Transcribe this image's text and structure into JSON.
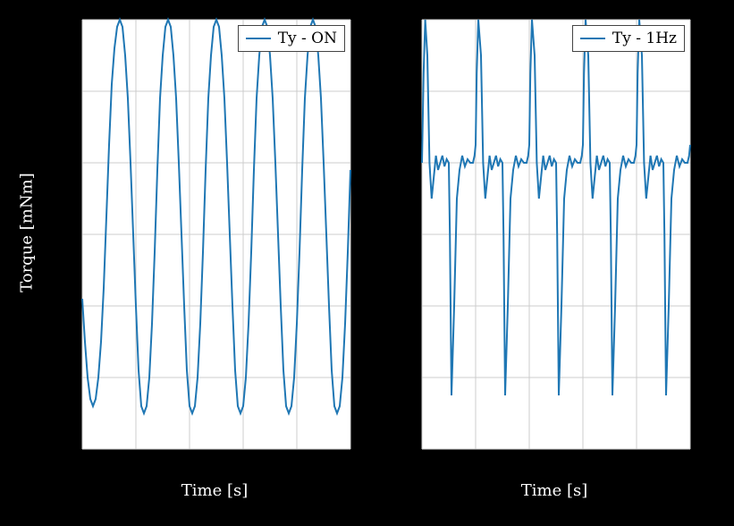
{
  "chart_data": [
    {
      "type": "line",
      "legend": "Ty - ON",
      "xlabel": "Time [s]",
      "ylabel": "Torque [mNm]",
      "xlim": [
        0,
        5
      ],
      "ylim": [
        -60,
        60
      ],
      "xticks": [
        0,
        1,
        2,
        3,
        4,
        5
      ],
      "yticks": [
        -60,
        -40,
        -20,
        0,
        20,
        40,
        60
      ],
      "series": [
        {
          "name": "Ty - ON",
          "x": [
            0.0,
            0.05,
            0.1,
            0.15,
            0.2,
            0.25,
            0.3,
            0.35,
            0.4,
            0.45,
            0.5,
            0.55,
            0.6,
            0.65,
            0.7,
            0.75,
            0.8,
            0.85,
            0.9,
            0.95,
            1.0,
            1.05,
            1.1,
            1.15,
            1.2,
            1.25,
            1.3,
            1.35,
            1.4,
            1.45,
            1.5,
            1.55,
            1.6,
            1.65,
            1.7,
            1.75,
            1.8,
            1.85,
            1.9,
            1.95,
            2.0,
            2.05,
            2.1,
            2.15,
            2.2,
            2.25,
            2.3,
            2.35,
            2.4,
            2.45,
            2.5,
            2.55,
            2.6,
            2.65,
            2.7,
            2.75,
            2.8,
            2.85,
            2.9,
            2.95,
            3.0,
            3.05,
            3.1,
            3.15,
            3.2,
            3.25,
            3.3,
            3.35,
            3.4,
            3.45,
            3.5,
            3.55,
            3.6,
            3.65,
            3.7,
            3.75,
            3.8,
            3.85,
            3.9,
            3.95,
            4.0,
            4.05,
            4.1,
            4.15,
            4.2,
            4.25,
            4.3,
            4.35,
            4.4,
            4.45,
            4.5,
            4.55,
            4.6,
            4.65,
            4.7,
            4.75,
            4.8,
            4.85,
            4.9,
            4.95,
            5.0
          ],
          "y": [
            -18,
            -30,
            -40,
            -46,
            -48,
            -46,
            -40,
            -30,
            -15,
            5,
            25,
            42,
            52,
            58,
            60,
            58,
            50,
            38,
            20,
            0,
            -20,
            -38,
            -48,
            -50,
            -48,
            -40,
            -25,
            -5,
            18,
            38,
            50,
            58,
            60,
            58,
            50,
            38,
            20,
            0,
            -20,
            -38,
            -48,
            -50,
            -48,
            -40,
            -25,
            -5,
            18,
            38,
            50,
            58,
            60,
            58,
            50,
            38,
            20,
            0,
            -20,
            -38,
            -48,
            -50,
            -48,
            -40,
            -25,
            -5,
            18,
            38,
            50,
            58,
            60,
            58,
            50,
            38,
            20,
            0,
            -20,
            -38,
            -48,
            -50,
            -48,
            -40,
            -25,
            -5,
            18,
            38,
            50,
            58,
            60,
            58,
            50,
            38,
            20,
            0,
            -20,
            -38,
            -48,
            -50,
            -48,
            -40,
            -25,
            -5,
            18
          ]
        }
      ]
    },
    {
      "type": "line",
      "legend": "Ty - 1Hz",
      "xlabel": "Time [s]",
      "ylabel": "Torque [mNm]",
      "xlim": [
        0,
        5
      ],
      "ylim": [
        -60,
        60
      ],
      "xticks": [
        0,
        1,
        2,
        3,
        4,
        5
      ],
      "yticks": [
        -60,
        -40,
        -20,
        0,
        20,
        40,
        60
      ],
      "series": [
        {
          "name": "Ty - 1Hz",
          "x": [
            0.0,
            0.03,
            0.06,
            0.1,
            0.14,
            0.18,
            0.22,
            0.26,
            0.3,
            0.34,
            0.38,
            0.42,
            0.46,
            0.5,
            0.52,
            0.55,
            0.6,
            0.65,
            0.7,
            0.75,
            0.8,
            0.85,
            0.9,
            0.95,
            0.98,
            1.0,
            1.02,
            1.05,
            1.1,
            1.14,
            1.18,
            1.22,
            1.26,
            1.3,
            1.34,
            1.38,
            1.42,
            1.46,
            1.5,
            1.52,
            1.55,
            1.6,
            1.65,
            1.7,
            1.75,
            1.8,
            1.85,
            1.9,
            1.95,
            1.98,
            2.0,
            2.02,
            2.05,
            2.1,
            2.14,
            2.18,
            2.22,
            2.26,
            2.3,
            2.34,
            2.38,
            2.42,
            2.46,
            2.5,
            2.52,
            2.55,
            2.6,
            2.65,
            2.7,
            2.75,
            2.8,
            2.85,
            2.9,
            2.95,
            2.98,
            3.0,
            3.02,
            3.05,
            3.1,
            3.14,
            3.18,
            3.22,
            3.26,
            3.3,
            3.34,
            3.38,
            3.42,
            3.46,
            3.5,
            3.52,
            3.55,
            3.6,
            3.65,
            3.7,
            3.75,
            3.8,
            3.85,
            3.9,
            3.95,
            3.98,
            4.0,
            4.02,
            4.05,
            4.1,
            4.14,
            4.18,
            4.22,
            4.26,
            4.3,
            4.34,
            4.38,
            4.42,
            4.46,
            4.5,
            4.52,
            4.55,
            4.6,
            4.65,
            4.7,
            4.75,
            4.8,
            4.85,
            4.9,
            4.95,
            4.98,
            5.0
          ],
          "y": [
            20,
            45,
            60,
            50,
            20,
            10,
            16,
            22,
            18,
            20,
            22,
            19,
            21,
            20,
            0,
            -45,
            -20,
            10,
            18,
            22,
            19,
            21,
            20,
            20,
            22,
            25,
            45,
            60,
            50,
            20,
            10,
            16,
            22,
            18,
            20,
            22,
            19,
            21,
            20,
            0,
            -45,
            -20,
            10,
            18,
            22,
            19,
            21,
            20,
            20,
            22,
            25,
            45,
            60,
            50,
            20,
            10,
            16,
            22,
            18,
            20,
            22,
            19,
            21,
            20,
            0,
            -45,
            -20,
            10,
            18,
            22,
            19,
            21,
            20,
            20,
            22,
            25,
            45,
            60,
            50,
            20,
            10,
            16,
            22,
            18,
            20,
            22,
            19,
            21,
            20,
            0,
            -45,
            -20,
            10,
            18,
            22,
            19,
            21,
            20,
            20,
            22,
            25,
            45,
            60,
            50,
            20,
            10,
            16,
            22,
            18,
            20,
            22,
            19,
            21,
            20,
            0,
            -45,
            -20,
            10,
            18,
            22,
            19,
            21,
            20,
            20,
            22,
            25
          ]
        }
      ]
    }
  ],
  "labels": {
    "xlabel": "Time [s]",
    "ylabel": "Torque [mNm]"
  },
  "legends": {
    "left": "Ty - ON",
    "right": "Ty - 1Hz"
  }
}
